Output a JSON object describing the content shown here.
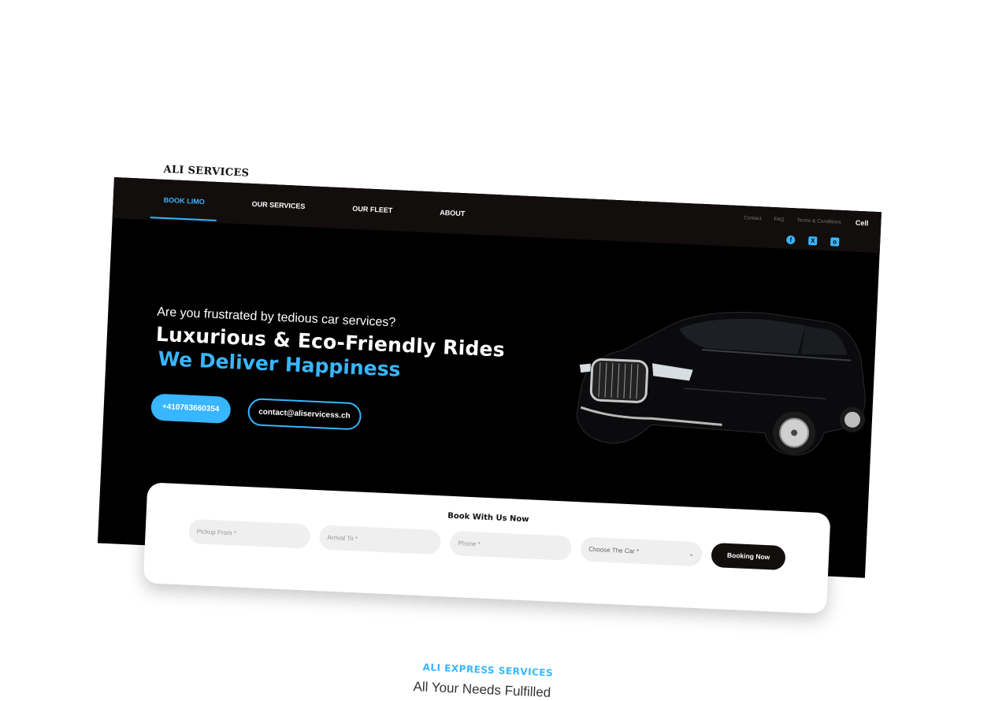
{
  "brand": "ALI SERVICES",
  "nav": {
    "items": [
      {
        "label": "BOOK LIMO",
        "active": true
      },
      {
        "label": "OUR SERVICES",
        "active": false
      },
      {
        "label": "OUR FLEET",
        "active": false
      },
      {
        "label": "ABOUT",
        "active": false
      }
    ]
  },
  "toplinks": {
    "contact": "Contact",
    "faq": "FAQ",
    "terms": "Terms & Conditions",
    "cell": "Cell"
  },
  "socials": [
    "facebook-icon",
    "x-icon",
    "instagram-icon"
  ],
  "hero": {
    "question": "Are you frustrated by tedious car services?",
    "title": "Luxurious & Eco-Friendly Rides",
    "tagline": "We Deliver Happiness",
    "phone": "+410763660354",
    "email": "contact@aliservicess.ch"
  },
  "booking": {
    "title": "Book With Us Now",
    "pickup_placeholder": "Pickup From *",
    "arrival_placeholder": "Arrival To *",
    "phone_placeholder": "Phone *",
    "car_select": "Choose The Car *",
    "submit": "Booking Now"
  },
  "section": {
    "tag": "ALI EXPRESS SERVICES",
    "heading": "All Your Needs Fulfilled"
  },
  "colors": {
    "accent": "#38b6ff",
    "dark": "#120e0d",
    "hero_bg": "#000000"
  }
}
